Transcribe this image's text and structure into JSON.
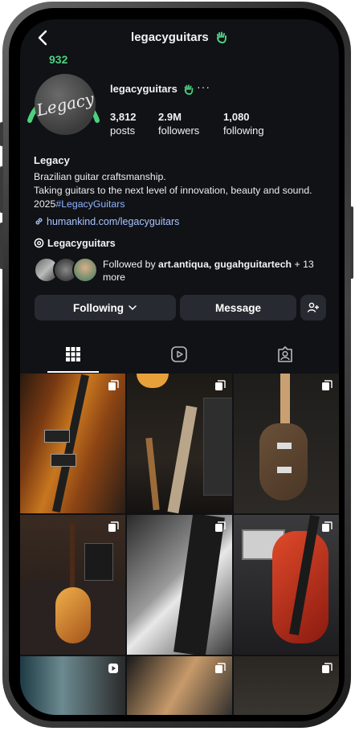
{
  "header": {
    "username": "legacyguitars",
    "verified_icon": "waving-hand-icon"
  },
  "profile": {
    "score": "932",
    "logo_text": "Legacy",
    "username": "legacyguitars",
    "stats": [
      {
        "value": "3,812",
        "label": "posts"
      },
      {
        "value": "2.9M",
        "label": "followers"
      },
      {
        "value": "1,080",
        "label": "following"
      }
    ],
    "display_name": "Legacy",
    "bio_line1": "Brazilian guitar craftsmanship.",
    "bio_line2": "Taking guitars to the next level of innovation, beauty and sound.",
    "bio_year": "2025",
    "bio_hashtag": "#LegacyGuitars",
    "link": "humankind.com/legacyguitars",
    "threads_name": "Legacyguitars",
    "followed_prefix": "Followed by",
    "followed_names": "art.antiqua, gugahguitartech",
    "followed_suffix": "+ 13 more"
  },
  "actions": {
    "following_label": "Following",
    "message_label": "Message"
  },
  "tabs": [
    "grid-icon",
    "reels-icon",
    "tagged-icon"
  ],
  "colors": {
    "background": "#101216",
    "button": "#272a30",
    "score": "#4bd17e",
    "link": "#a9c4ff",
    "hashtag": "#8fb4ff"
  },
  "grid_posts": [
    {
      "type": "carousel",
      "subject": "sunburst electric guitar"
    },
    {
      "type": "carousel",
      "subject": "guitar headstock in studio"
    },
    {
      "type": "carousel",
      "subject": "brown electric guitar"
    },
    {
      "type": "carousel",
      "subject": "sunburst guitar on sofa with amp"
    },
    {
      "type": "carousel",
      "subject": "white guitar close-up"
    },
    {
      "type": "carousel",
      "subject": "red electric guitar with amp"
    },
    {
      "type": "reel",
      "subject": "workshop"
    },
    {
      "type": "carousel",
      "subject": "wood figure close-up"
    },
    {
      "type": "carousel",
      "subject": "amp close-up"
    }
  ]
}
